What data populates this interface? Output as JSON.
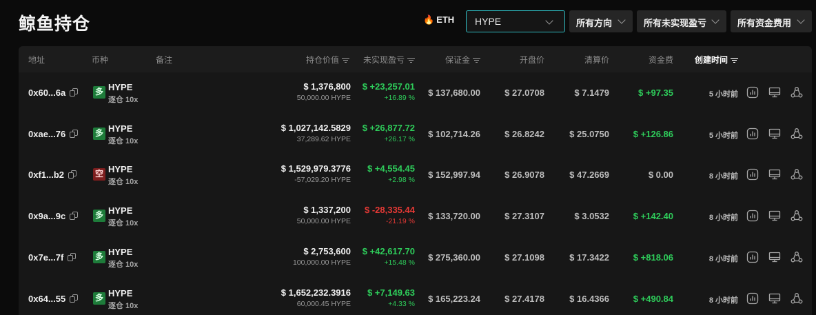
{
  "page": {
    "title": "鲸鱼持仓"
  },
  "filters": {
    "eth_label": "ETH",
    "eth_icon": "fire-icon",
    "coin_select": "HYPE",
    "direction": "所有方向",
    "unrealized": "所有未实现盈亏",
    "funding": "所有资金费用"
  },
  "table": {
    "headers": {
      "address": "地址",
      "coin": "币种",
      "note": "备注",
      "position_value": "持仓价值",
      "unrealized_pnl": "未实现盈亏",
      "margin": "保证金",
      "open_price": "开盘价",
      "liq_price": "清算价",
      "funding": "资金费",
      "created": "创建时间"
    },
    "rows": [
      {
        "address": "0x60...6a",
        "side": "多",
        "side_type": "long",
        "coin": "HYPE",
        "leverage": "逐仓 10x",
        "value": "$ 1,376,800",
        "size": "50,000.00 HYPE",
        "pnl": "$ +23,257.01",
        "pnl_pct": "+16.89 %",
        "pnl_sign": "pos",
        "margin": "$ 137,680.00",
        "open": "$ 27.0708",
        "liq": "$ 7.1479",
        "funding": "$ +97.35",
        "funding_sign": "pos",
        "time": "5 小时前"
      },
      {
        "address": "0xae...76",
        "side": "多",
        "side_type": "long",
        "coin": "HYPE",
        "leverage": "逐仓 10x",
        "value": "$ 1,027,142.5829",
        "size": "37,289.62 HYPE",
        "pnl": "$ +26,877.72",
        "pnl_pct": "+26.17 %",
        "pnl_sign": "pos",
        "margin": "$ 102,714.26",
        "open": "$ 26.8242",
        "liq": "$ 25.0750",
        "funding": "$ +126.86",
        "funding_sign": "pos",
        "time": "5 小时前"
      },
      {
        "address": "0xf1...b2",
        "side": "空",
        "side_type": "short",
        "coin": "HYPE",
        "leverage": "逐仓 10x",
        "value": "$ 1,529,979.3776",
        "size": "-57,029.20 HYPE",
        "pnl": "$ +4,554.45",
        "pnl_pct": "+2.98 %",
        "pnl_sign": "pos",
        "margin": "$ 152,997.94",
        "open": "$ 26.9078",
        "liq": "$ 47.2669",
        "funding": "$ 0.00",
        "funding_sign": "zero",
        "time": "8 小时前"
      },
      {
        "address": "0x9a...9c",
        "side": "多",
        "side_type": "long",
        "coin": "HYPE",
        "leverage": "逐仓 10x",
        "value": "$ 1,337,200",
        "size": "50,000.00 HYPE",
        "pnl": "$ -28,335.44",
        "pnl_pct": "-21.19 %",
        "pnl_sign": "neg",
        "margin": "$ 133,720.00",
        "open": "$ 27.3107",
        "liq": "$ 3.0532",
        "funding": "$ +142.40",
        "funding_sign": "pos",
        "time": "8 小时前"
      },
      {
        "address": "0x7e...7f",
        "side": "多",
        "side_type": "long",
        "coin": "HYPE",
        "leverage": "逐仓 10x",
        "value": "$ 2,753,600",
        "size": "100,000.00 HYPE",
        "pnl": "$ +42,617.70",
        "pnl_pct": "+15.48 %",
        "pnl_sign": "pos",
        "margin": "$ 275,360.00",
        "open": "$ 27.1098",
        "liq": "$ 17.3422",
        "funding": "$ +818.06",
        "funding_sign": "pos",
        "time": "8 小时前"
      },
      {
        "address": "0x64...55",
        "side": "多",
        "side_type": "long",
        "coin": "HYPE",
        "leverage": "逐仓 10x",
        "value": "$ 1,652,232.3916",
        "size": "60,000.45 HYPE",
        "pnl": "$ +7,149.63",
        "pnl_pct": "+4.33 %",
        "pnl_sign": "pos",
        "margin": "$ 165,223.24",
        "open": "$ 27.4178",
        "liq": "$ 16.4366",
        "funding": "$ +490.84",
        "funding_sign": "pos",
        "time": "8 小时前"
      }
    ],
    "row_icons": [
      "chart-icon",
      "monitor-icon",
      "share-icon"
    ]
  },
  "colors": {
    "positive": "#2ecc5a",
    "negative": "#e53935",
    "accent": "#2fb9bf",
    "long_badge": "#1e7c3a",
    "short_badge": "#7d1e1e"
  }
}
